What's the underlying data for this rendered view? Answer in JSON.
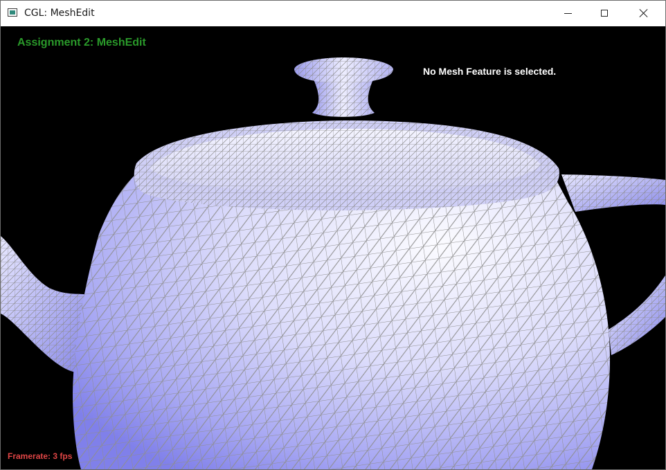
{
  "window": {
    "title": "CGL: MeshEdit",
    "icon": "app-window-icon",
    "controls": {
      "minimize": "minimize-icon",
      "maximize": "maximize-icon",
      "close": "close-icon"
    }
  },
  "hud": {
    "title": "Assignment 2: MeshEdit",
    "status": "No Mesh Feature is selected.",
    "framerate": "Framerate: 3 fps"
  },
  "colors": {
    "background": "#000000",
    "title": "#2a9a2a",
    "status": "#ffffff",
    "framerate": "#e04545",
    "mesh_fill_light": "#f2f2ff",
    "mesh_fill_dark": "#8c8cf0",
    "wireframe": "#8a8a8a"
  }
}
